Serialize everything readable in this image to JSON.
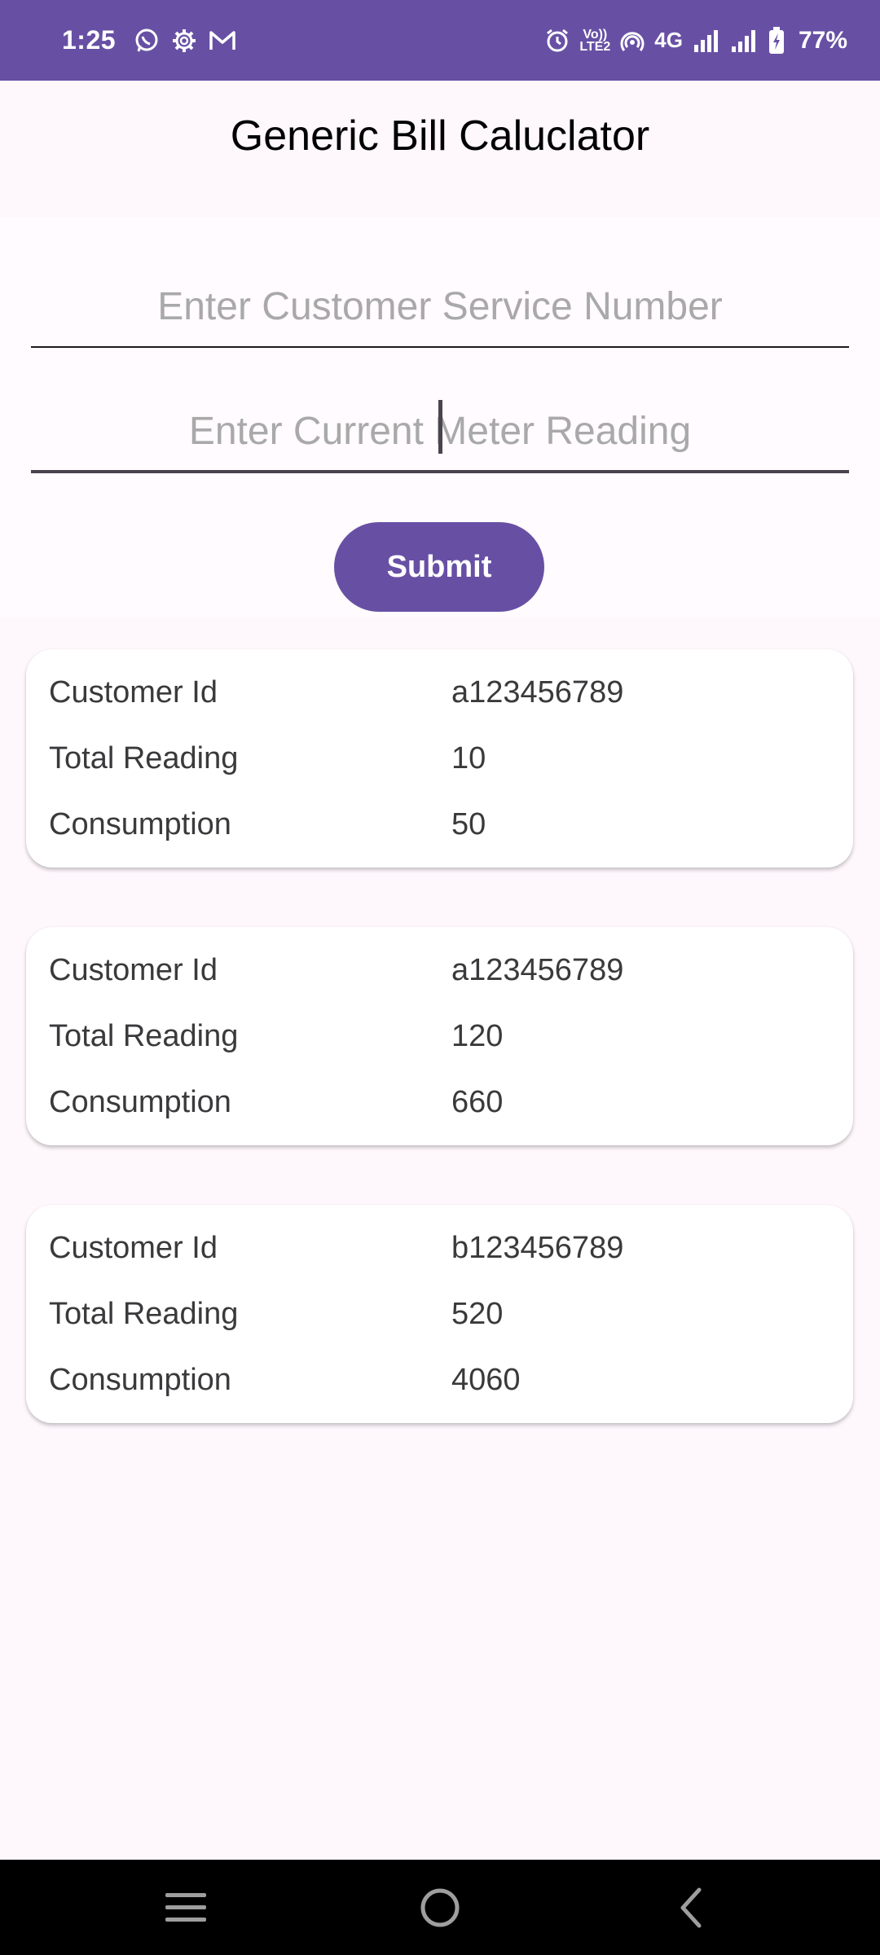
{
  "status_bar": {
    "time": "1:25",
    "volte_line1": "Vo))",
    "volte_line2": "LTE2",
    "network": "4G",
    "battery": "77%",
    "left_icons": [
      "whatsapp-icon",
      "settings-gear-icon",
      "gmail-icon"
    ],
    "right_icons": [
      "alarm-icon",
      "volte-icon",
      "hotspot-icon",
      "signal-icon",
      "battery-icon"
    ]
  },
  "header": {
    "title": "Generic Bill Caluclator"
  },
  "form": {
    "service_number_placeholder": "Enter Customer Service Number",
    "meter_reading_placeholder": "Enter Current Meter Reading",
    "submit_label": "Submit"
  },
  "cards": [
    {
      "rows": [
        {
          "label": "Customer Id",
          "value": "a123456789"
        },
        {
          "label": "Total Reading",
          "value": "10"
        },
        {
          "label": "Consumption",
          "value": "50"
        }
      ]
    },
    {
      "rows": [
        {
          "label": "Customer Id",
          "value": "a123456789"
        },
        {
          "label": "Total Reading",
          "value": "120"
        },
        {
          "label": "Consumption",
          "value": "660"
        }
      ]
    },
    {
      "rows": [
        {
          "label": "Customer Id",
          "value": "b123456789"
        },
        {
          "label": "Total Reading",
          "value": "520"
        },
        {
          "label": "Consumption",
          "value": "4060"
        }
      ]
    }
  ],
  "nav": {
    "icons": [
      "recent-apps-icon",
      "home-icon",
      "back-icon"
    ]
  },
  "colors": {
    "primary": "#6750A4",
    "background": "#FEF7FC",
    "card": "#FFFFFF",
    "nav": "#000000"
  }
}
